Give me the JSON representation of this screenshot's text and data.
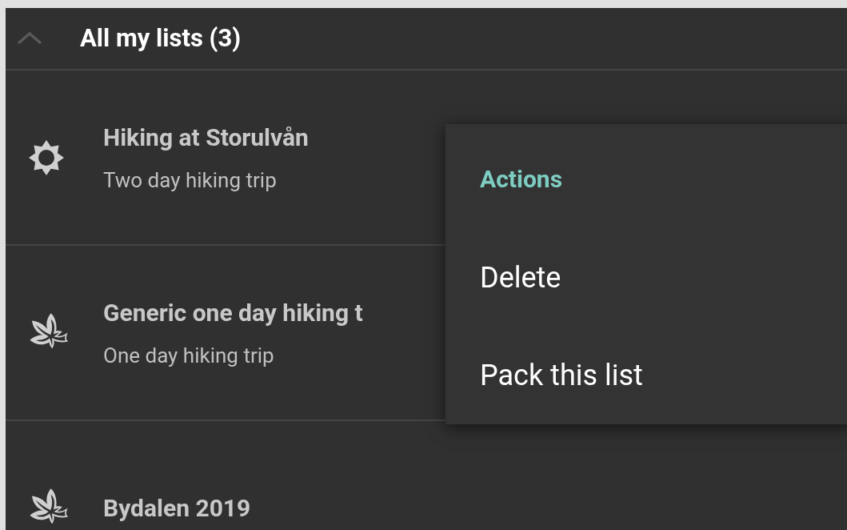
{
  "header": {
    "title": "All my lists (3)",
    "expanded": true
  },
  "lists": [
    {
      "kind": "sun",
      "title": "Hiking at Storulvån",
      "subtitle": "Two day hiking trip"
    },
    {
      "kind": "leaf",
      "title": "Generic one day hiking t",
      "subtitle": "One day hiking trip"
    },
    {
      "kind": "leaf",
      "title": "Bydalen 2019"
    }
  ],
  "menu": {
    "title": "Actions",
    "items": [
      "Delete",
      "Pack this list"
    ]
  }
}
